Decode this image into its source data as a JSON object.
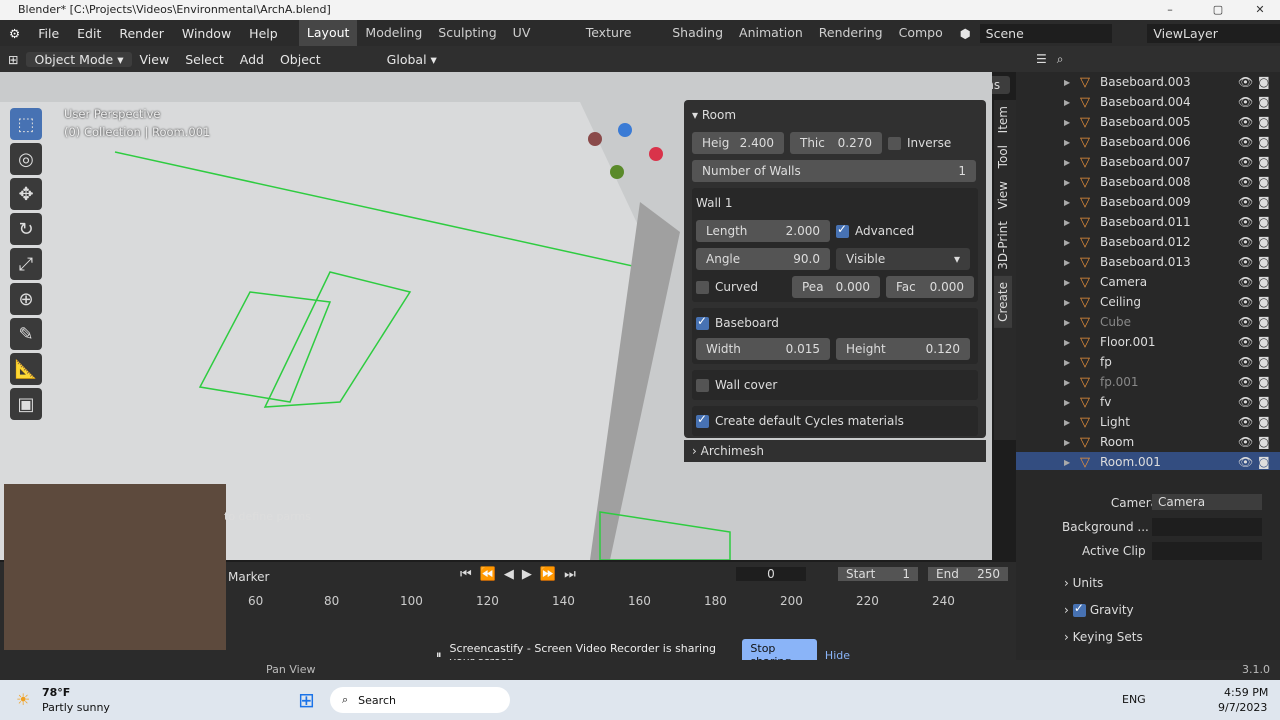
{
  "window": {
    "title": "Blender* [C:\\Projects\\Videos\\Environmental\\ArchA.blend]"
  },
  "menu": [
    "File",
    "Edit",
    "Render",
    "Window",
    "Help"
  ],
  "workspaces": [
    "Layout",
    "Modeling",
    "Sculpting",
    "UV Editing",
    "Texture Paint",
    "Shading",
    "Animation",
    "Rendering",
    "Compo"
  ],
  "scene": "Scene",
  "view_layer": "ViewLayer",
  "header": {
    "mode": "Object Mode",
    "view": "View",
    "select": "Select",
    "add": "Add",
    "object": "Object",
    "orientation": "Global",
    "options": "Options"
  },
  "viewport": {
    "line1": "User Perspective",
    "line2": "(0) Collection | Room.001"
  },
  "panel": {
    "title": "Room",
    "height_label": "Heig",
    "height_val": "2.400",
    "thick_label": "Thic",
    "thick_val": "0.270",
    "inverse": "Inverse",
    "walls_label": "Number of Walls",
    "walls_val": "1",
    "wall_title": "Wall 1",
    "length_label": "Length",
    "length_val": "2.000",
    "advanced": "Advanced",
    "angle_label": "Angle",
    "angle_val": "90.0",
    "visible": "Visible",
    "curved": "Curved",
    "pea_label": "Pea",
    "pea_val": "0.000",
    "fac_label": "Fac",
    "fac_val": "0.000",
    "baseboard": "Baseboard",
    "width_label": "Width",
    "width_val": "0.015",
    "bheight_label": "Height",
    "bheight_val": "0.120",
    "wallcover": "Wall cover",
    "cycles": "Create default Cycles materials",
    "archimesh": "Archimesh"
  },
  "side_tabs": [
    "Item",
    "Tool",
    "View",
    "3D-Print",
    "Create"
  ],
  "outliner": [
    {
      "name": "Baseboard.003"
    },
    {
      "name": "Baseboard.004"
    },
    {
      "name": "Baseboard.005"
    },
    {
      "name": "Baseboard.006"
    },
    {
      "name": "Baseboard.007"
    },
    {
      "name": "Baseboard.008"
    },
    {
      "name": "Baseboard.009"
    },
    {
      "name": "Baseboard.011"
    },
    {
      "name": "Baseboard.012"
    },
    {
      "name": "Baseboard.013"
    },
    {
      "name": "Camera"
    },
    {
      "name": "Ceiling"
    },
    {
      "name": "Cube"
    },
    {
      "name": "Floor.001"
    },
    {
      "name": "fp"
    },
    {
      "name": "fp.001"
    },
    {
      "name": "fv"
    },
    {
      "name": "Light"
    },
    {
      "name": "Room"
    },
    {
      "name": "Room.001"
    }
  ],
  "props": {
    "camera_label": "Camera",
    "camera_val": "Camera",
    "background": "Background ...",
    "active_clip": "Active Clip",
    "units": "Units",
    "gravity": "Gravity",
    "keying": "Keying Sets"
  },
  "timeline": {
    "marker": "Marker",
    "frame": "0",
    "start_label": "Start",
    "start": "1",
    "end_label": "End",
    "end": "250",
    "ticks": [
      "60",
      "80",
      "100",
      "120",
      "140",
      "160",
      "180",
      "200",
      "220",
      "240"
    ]
  },
  "overlay": {
    "hint": "to define parms"
  },
  "share": {
    "msg": "Screencastify - Screen Video Recorder is sharing your screen.",
    "stop": "Stop sharing",
    "hide": "Hide"
  },
  "status": {
    "pan": "Pan View",
    "version": "3.1.0"
  },
  "taskbar": {
    "temp": "78°F",
    "weather": "Partly sunny",
    "search": "Search",
    "lang": "ENG",
    "time": "4:59 PM",
    "date": "9/7/2023"
  }
}
